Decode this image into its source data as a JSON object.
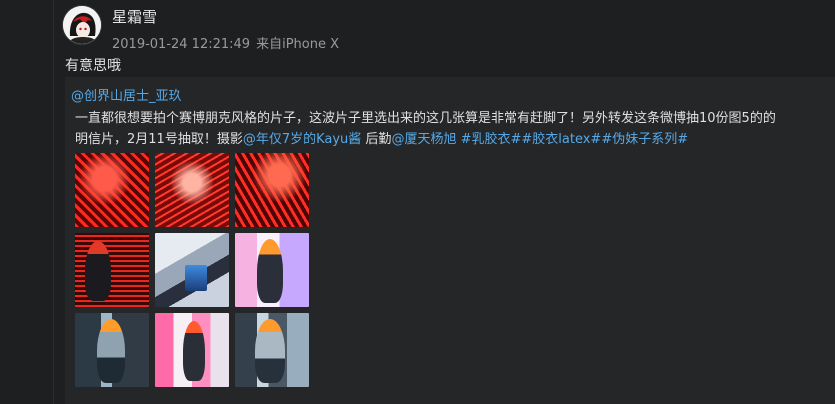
{
  "post": {
    "author": "星霜雪",
    "timestamp": "2019-01-24 12:21:49",
    "source": "来自iPhone X",
    "text": "有意思哦",
    "repost": {
      "author": "@创界山居士_亚玖",
      "text_line1": "一直都很想要拍个赛博朋克风格的片子，这波片子里选出来的这几张算是非常有赶脚了！另外转发这条微博抽10份图5的的",
      "text_line2_prefix": "明信片，2月11号抽取！摄影",
      "mention1": "@年仅7岁的Kayu酱",
      "text_mid": " 后勤",
      "mention2": "@厦天杨旭",
      "space": " ",
      "tag1": "#乳胶衣#",
      "tag2": "#胶衣latex#",
      "tag3": "#伪妹子系列#",
      "images": [
        "photo-1",
        "photo-2",
        "photo-3",
        "photo-4",
        "photo-5",
        "photo-6",
        "photo-7",
        "photo-8",
        "photo-9"
      ]
    }
  }
}
